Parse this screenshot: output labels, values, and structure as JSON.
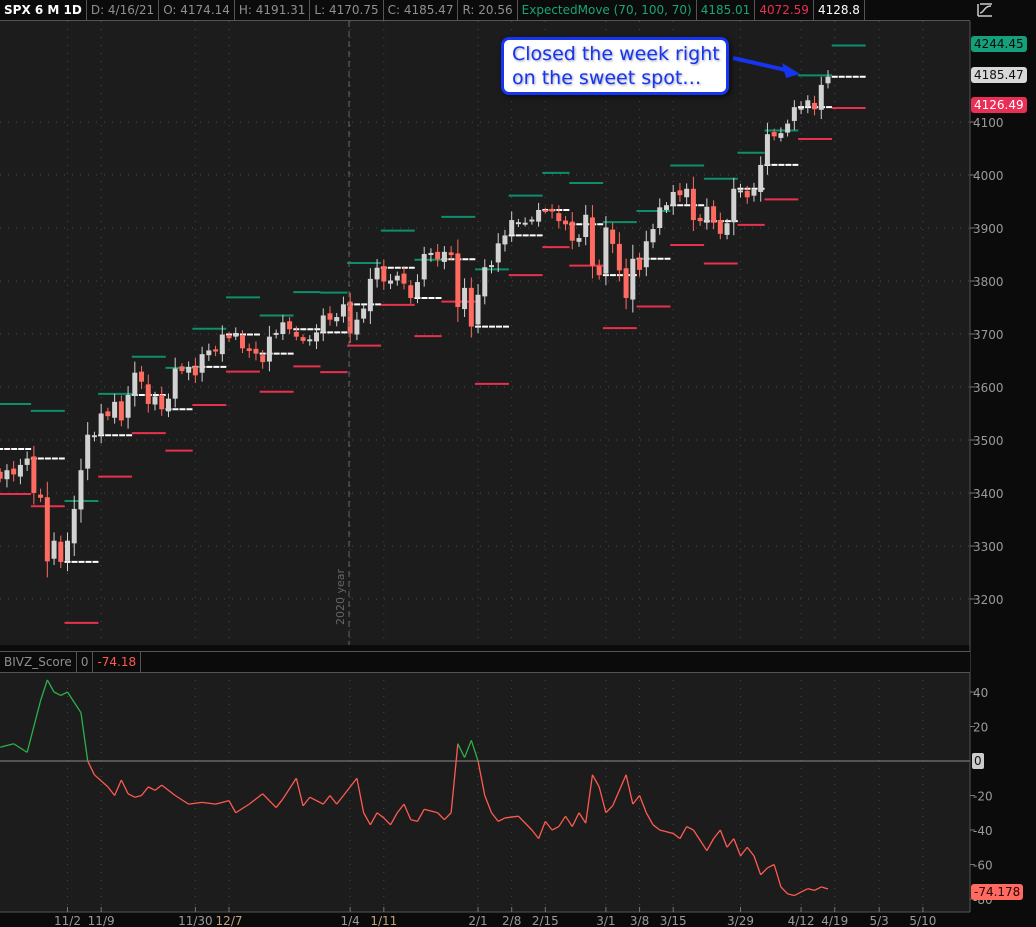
{
  "header": {
    "symbol": "SPX 6 M 1D",
    "date": "D: 4/16/21",
    "open": "O: 4174.14",
    "high": "H: 4191.31",
    "low": "L: 4170.75",
    "close": "C: 4185.47",
    "range": "R: 20.56",
    "study": "ExpectedMove (70, 100, 70)",
    "study_upper": "4185.01",
    "study_lower": "4072.59",
    "study_mid": "4128.8",
    "style_icon": "chart-style-icon"
  },
  "annotation": {
    "line1": "Closed the week right",
    "line2": "on the sweet spot…"
  },
  "price_badges": {
    "upper": "4244.45",
    "last": "4185.47",
    "lower": "4126.49"
  },
  "oscillator": {
    "name": "BIVZ_Score",
    "param": "0",
    "value": "-74.18",
    "badge": "-74.178",
    "zero_label": "0"
  },
  "colors": {
    "up": "#d2d2d2",
    "down": "#ff6b61",
    "upper": "#0e8f6c",
    "lower": "#e8304f",
    "center": "#ffffff",
    "osc_pos": "#2bb14a",
    "osc_neg": "#ff5a50",
    "annotation": "#1535f0"
  },
  "vertical_marker": "2020 year",
  "chart_data": [
    {
      "type": "candlestick",
      "title": "SPX 6 M 1D",
      "ylim": [
        3120,
        4300
      ],
      "y_ticks": [
        "3200",
        "3300",
        "3400",
        "3500",
        "3600",
        "3700",
        "3800",
        "3900",
        "4000",
        "4100"
      ],
      "x_ticks": [
        {
          "label": "11/2",
          "day": 10
        },
        {
          "label": "11/9",
          "day": 15
        },
        {
          "label": "11/30",
          "day": 29
        },
        {
          "label": "12/7",
          "day": 34
        },
        {
          "label": "1/4",
          "day": 52
        },
        {
          "label": "1/11",
          "day": 57
        },
        {
          "label": "2/1",
          "day": 71
        },
        {
          "label": "2/8",
          "day": 76
        },
        {
          "label": "2/15",
          "day": 81
        },
        {
          "label": "3/1",
          "day": 90
        },
        {
          "label": "3/8",
          "day": 95
        },
        {
          "label": "3/15",
          "day": 100
        },
        {
          "label": "3/29",
          "day": 110
        },
        {
          "label": "4/12",
          "day": 119
        },
        {
          "label": "4/19",
          "day": 124
        },
        {
          "label": "5/3",
          "day": 130.6
        },
        {
          "label": "5/10",
          "day": 137.1
        }
      ],
      "closes": [
        3427,
        3443,
        3435,
        3453,
        3465,
        3400,
        3391,
        3271,
        3310,
        3270,
        3310,
        3370,
        3443,
        3510,
        3509,
        3550,
        3545,
        3572,
        3537,
        3585,
        3627,
        3610,
        3568,
        3582,
        3558,
        3578,
        3635,
        3630,
        3638,
        3622,
        3662,
        3669,
        3667,
        3699,
        3692,
        3702,
        3673,
        3668,
        3663,
        3647,
        3695,
        3702,
        3722,
        3709,
        3695,
        3687,
        3690,
        3703,
        3735,
        3727,
        3732,
        3756,
        3701,
        3727,
        3748,
        3804,
        3825,
        3799,
        3801,
        3810,
        3795,
        3768,
        3798,
        3851,
        3853,
        3841,
        3855,
        3849,
        3751,
        3787,
        3714,
        3774,
        3826,
        3830,
        3871,
        3886,
        3915,
        3911,
        3910,
        3916,
        3934,
        3932,
        3931,
        3913,
        3907,
        3876,
        3881,
        3925,
        3829,
        3811,
        3901,
        3870,
        3820,
        3768,
        3842,
        3821,
        3875,
        3898,
        3939,
        3943,
        3968,
        3962,
        3974,
        3915,
        3913,
        3940,
        3910,
        3889,
        3909,
        3974,
        3971,
        3958,
        3972,
        4019,
        4077,
        4073,
        4079,
        4097,
        4128,
        4127,
        4141,
        4124,
        4170,
        4185.47
      ],
      "first_open": 3440,
      "expected_move_weeks": [
        {
          "start": 0,
          "len": 5,
          "center": 3483,
          "em": 85
        },
        {
          "start": 5,
          "len": 5,
          "center": 3465,
          "em": 90
        },
        {
          "start": 10,
          "len": 5,
          "center": 3270,
          "em": 115
        },
        {
          "start": 15,
          "len": 5,
          "center": 3509,
          "em": 78
        },
        {
          "start": 20,
          "len": 5,
          "center": 3585,
          "em": 72
        },
        {
          "start": 25,
          "len": 4,
          "center": 3558,
          "em": 78
        },
        {
          "start": 29,
          "len": 5,
          "center": 3638,
          "em": 72
        },
        {
          "start": 34,
          "len": 5,
          "center": 3699,
          "em": 70
        },
        {
          "start": 39,
          "len": 5,
          "center": 3663,
          "em": 72
        },
        {
          "start": 44,
          "len": 4,
          "center": 3709,
          "em": 70
        },
        {
          "start": 48,
          "len": 4,
          "center": 3703,
          "em": 75
        },
        {
          "start": 52,
          "len": 5,
          "center": 3756,
          "em": 78
        },
        {
          "start": 57,
          "len": 5,
          "center": 3825,
          "em": 70
        },
        {
          "start": 62,
          "len": 4,
          "center": 3768,
          "em": 72
        },
        {
          "start": 66,
          "len": 5,
          "center": 3841,
          "em": 80
        },
        {
          "start": 71,
          "len": 5,
          "center": 3714,
          "em": 108
        },
        {
          "start": 76,
          "len": 5,
          "center": 3886,
          "em": 75
        },
        {
          "start": 81,
          "len": 4,
          "center": 3934,
          "em": 70
        },
        {
          "start": 85,
          "len": 5,
          "center": 3907,
          "em": 78
        },
        {
          "start": 90,
          "len": 5,
          "center": 3811,
          "em": 100
        },
        {
          "start": 95,
          "len": 5,
          "center": 3842,
          "em": 90
        },
        {
          "start": 100,
          "len": 5,
          "center": 3943,
          "em": 75
        },
        {
          "start": 105,
          "len": 5,
          "center": 3913,
          "em": 80
        },
        {
          "start": 110,
          "len": 4,
          "center": 3974,
          "em": 68
        },
        {
          "start": 114,
          "len": 5,
          "center": 4019,
          "em": 65
        },
        {
          "start": 119,
          "len": 5,
          "center": 4128,
          "em": 60
        },
        {
          "start": 124,
          "len": 5,
          "center": 4185.47,
          "upper": 4244.45,
          "lower": 4126.49
        }
      ]
    },
    {
      "type": "line",
      "title": "BIVZ_Score",
      "ylim": [
        -84,
        52
      ],
      "y_ticks": [
        "40",
        "20",
        "-20",
        "-40",
        "-60",
        "-80"
      ],
      "zero_line": 0,
      "points": [
        [
          0,
          8
        ],
        [
          2,
          10
        ],
        [
          4,
          5
        ],
        [
          6,
          35
        ],
        [
          7,
          47
        ],
        [
          8,
          40
        ],
        [
          9,
          38
        ],
        [
          10,
          40
        ],
        [
          11,
          34
        ],
        [
          12,
          28
        ],
        [
          13,
          0
        ],
        [
          14,
          -8
        ],
        [
          16,
          -15
        ],
        [
          17,
          -20
        ],
        [
          18,
          -11
        ],
        [
          19,
          -19
        ],
        [
          20,
          -21
        ],
        [
          21,
          -20
        ],
        [
          22,
          -15
        ],
        [
          23,
          -17
        ],
        [
          24,
          -14
        ],
        [
          26,
          -20
        ],
        [
          28,
          -25
        ],
        [
          30,
          -24
        ],
        [
          32,
          -25
        ],
        [
          34,
          -23
        ],
        [
          35,
          -30
        ],
        [
          37,
          -25
        ],
        [
          39,
          -19
        ],
        [
          40,
          -23
        ],
        [
          41,
          -27
        ],
        [
          42,
          -22
        ],
        [
          44,
          -10
        ],
        [
          45,
          -26
        ],
        [
          46,
          -21
        ],
        [
          48,
          -25
        ],
        [
          49,
          -20
        ],
        [
          50,
          -25
        ],
        [
          51,
          -20
        ],
        [
          53,
          -10
        ],
        [
          54,
          -30
        ],
        [
          55,
          -37
        ],
        [
          56,
          -30
        ],
        [
          57,
          -33
        ],
        [
          58,
          -37
        ],
        [
          59,
          -30
        ],
        [
          60,
          -25
        ],
        [
          61,
          -34
        ],
        [
          62,
          -35
        ],
        [
          63,
          -28
        ],
        [
          65,
          -30
        ],
        [
          66,
          -34
        ],
        [
          67,
          -30
        ],
        [
          68,
          10
        ],
        [
          69,
          2
        ],
        [
          70,
          12
        ],
        [
          71,
          0
        ],
        [
          72,
          -20
        ],
        [
          73,
          -30
        ],
        [
          74,
          -35
        ],
        [
          75,
          -33
        ],
        [
          77,
          -32
        ],
        [
          79,
          -40
        ],
        [
          80,
          -45
        ],
        [
          81,
          -35
        ],
        [
          82,
          -40
        ],
        [
          83,
          -38
        ],
        [
          84,
          -32
        ],
        [
          85,
          -38
        ],
        [
          86,
          -30
        ],
        [
          87,
          -36
        ],
        [
          88,
          -8
        ],
        [
          89,
          -15
        ],
        [
          90,
          -30
        ],
        [
          91,
          -26
        ],
        [
          93,
          -8
        ],
        [
          94,
          -25
        ],
        [
          95,
          -20
        ],
        [
          96,
          -30
        ],
        [
          97,
          -37
        ],
        [
          98,
          -40
        ],
        [
          100,
          -42
        ],
        [
          101,
          -45
        ],
        [
          102,
          -38
        ],
        [
          103,
          -40
        ],
        [
          105,
          -52
        ],
        [
          106,
          -45
        ],
        [
          107,
          -40
        ],
        [
          108,
          -50
        ],
        [
          109,
          -45
        ],
        [
          110,
          -55
        ],
        [
          111,
          -50
        ],
        [
          112,
          -55
        ],
        [
          113,
          -66
        ],
        [
          114,
          -62
        ],
        [
          115,
          -60
        ],
        [
          116,
          -73
        ],
        [
          117,
          -77
        ],
        [
          118,
          -78
        ],
        [
          119,
          -76
        ],
        [
          120,
          -74
        ],
        [
          121,
          -75
        ],
        [
          122,
          -73
        ],
        [
          123,
          -74.18
        ]
      ]
    }
  ]
}
